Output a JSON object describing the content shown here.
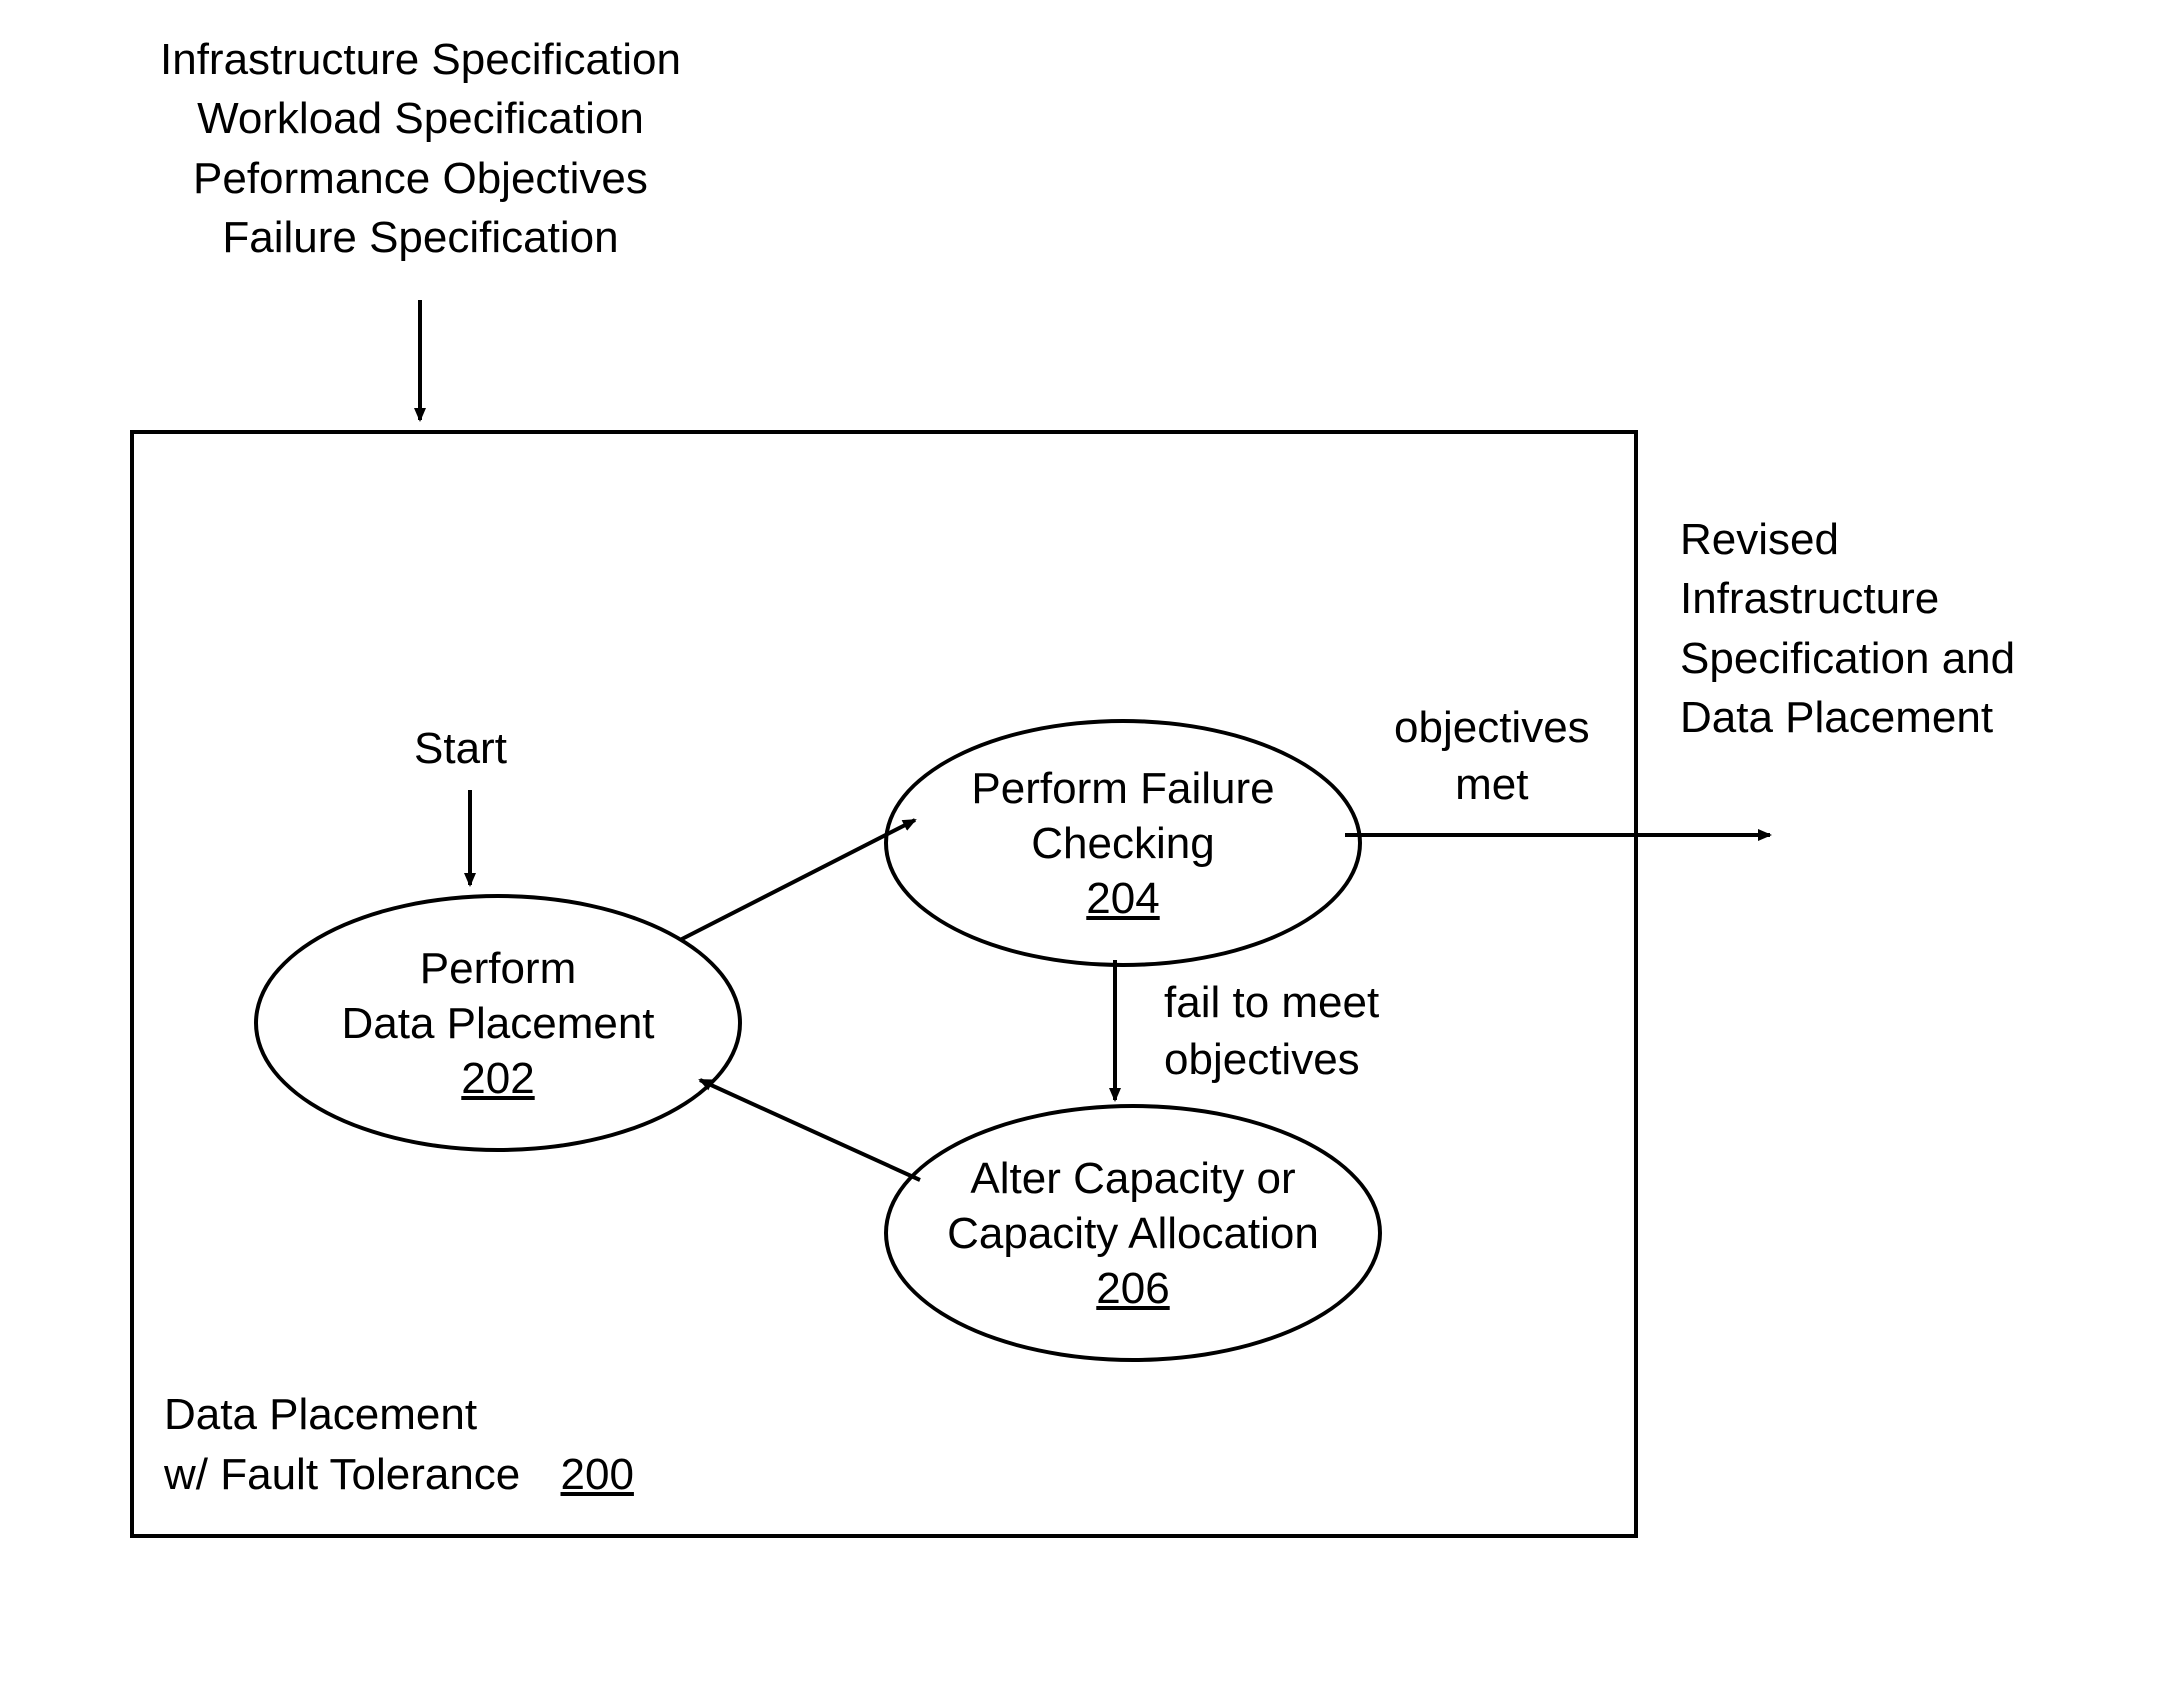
{
  "inputs": {
    "line1": "Infrastructure Specification",
    "line2": "Workload Specification",
    "line3": "Peformance Objectives",
    "line4": "Failure Specification"
  },
  "box": {
    "title_line1": "Data Placement",
    "title_line2": "w/ Fault Tolerance",
    "ref": "200"
  },
  "start_label": "Start",
  "node_202": {
    "line1": "Perform",
    "line2": "Data Placement",
    "ref": "202"
  },
  "node_204": {
    "line1": "Perform Failure",
    "line2": "Checking",
    "ref": "204"
  },
  "node_206": {
    "line1": "Alter Capacity or",
    "line2": "Capacity Allocation",
    "ref": "206"
  },
  "edge_met": {
    "line1": "objectives",
    "line2": "met"
  },
  "edge_fail": {
    "line1": "fail to meet",
    "line2": "objectives"
  },
  "outputs": {
    "line1": "Revised",
    "line2": "Infrastructure",
    "line3": "Specification and",
    "line4": "Data Placement"
  }
}
